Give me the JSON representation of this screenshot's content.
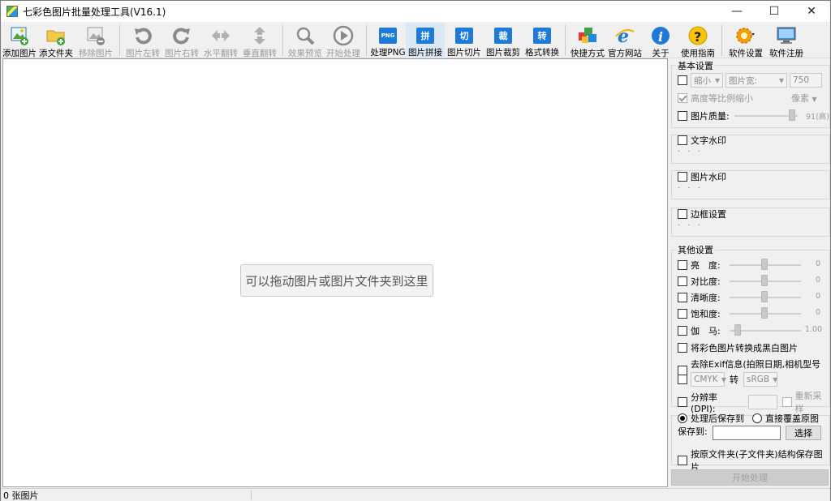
{
  "window": {
    "title": "七彩色图片批量处理工具(V16.1)",
    "minimize": "—",
    "maximize": "☐",
    "close": "✕"
  },
  "toolbar": {
    "add_image": "添加图片",
    "add_folder": "添文件夹",
    "remove_image": "移除图片",
    "rotate_left": "图片左转",
    "rotate_right": "图片右转",
    "flip_h": "水平翻转",
    "flip_v": "垂直翻转",
    "preview": "效果预览",
    "start": "开始处理",
    "png": "处理PNG",
    "png_badge": "PNG",
    "splice": "图片拼接",
    "splice_badge": "拼",
    "slice": "图片切片",
    "slice_badge": "切",
    "crop": "图片裁剪",
    "crop_badge": "裁",
    "convert": "格式转换",
    "convert_badge": "转",
    "shortcut": "快捷方式",
    "website": "官方网站",
    "about": "关于",
    "guide": "使用指南",
    "settings": "软件设置",
    "register": "软件注册"
  },
  "drop_area": {
    "hint": "可以拖动图片或图片文件夹到这里"
  },
  "panel": {
    "basic_title": "基本设置",
    "shrink_value": "缩小",
    "width_mode": "图片宽:",
    "width_value": "750",
    "keep_ratio": "高度等比例缩小",
    "unit": "像素",
    "quality_label": "图片质量:",
    "quality_value": "91(高)",
    "quality_level": 91,
    "text_watermark": "文字水印",
    "image_watermark": "图片水印",
    "border": "边框设置",
    "dots": "· · ·",
    "other_title": "其他设置",
    "brightness": "亮　度:",
    "brightness_value": "0",
    "contrast": "对比度:",
    "contrast_value": "0",
    "sharpness": "清晰度:",
    "sharpness_value": "0",
    "saturation": "饱和度:",
    "saturation_value": "0",
    "gamma": "伽　马:",
    "gamma_value": "1.00",
    "to_bw": "将彩色图片转换成黑白图片",
    "remove_exif": "去除Exif信息(拍照日期,相机型号等)",
    "color_from": "CMYK",
    "color_to_label": "转",
    "color_to": "sRGB",
    "dpi_label": "分辨率(DPI):",
    "resample": "重新采样",
    "save_after": "处理后保存到",
    "overwrite": "直接覆盖原图",
    "save_to_label": "保存到:",
    "choose_button": "选择",
    "keep_structure": "按原文件夹(子文件夹)结构保存图片",
    "start_button": "开始处理"
  },
  "status": {
    "count": "0 张图片"
  }
}
